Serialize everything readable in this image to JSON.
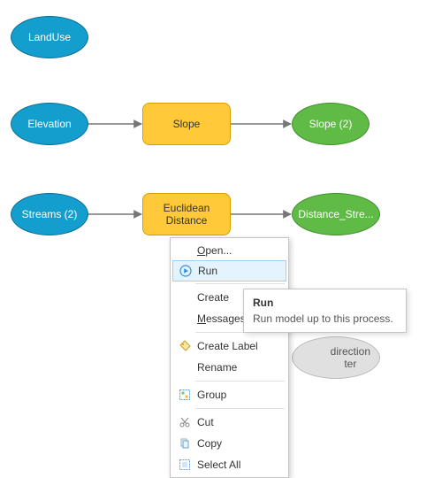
{
  "nodes": {
    "landuse": {
      "label": "LandUse"
    },
    "elevation": {
      "label": "Elevation"
    },
    "slope_tool": {
      "label": "Slope"
    },
    "slope_out": {
      "label": "Slope (2)"
    },
    "streams": {
      "label": "Streams (2)"
    },
    "eucdist": {
      "label": "Euclidean\nDistance"
    },
    "dist_out": {
      "label": "Distance_Stre..."
    },
    "outdir": {
      "label": "direction\nter"
    }
  },
  "menu": {
    "open": "Open...",
    "run": "Run",
    "create": "Create",
    "messages": "Messages",
    "createLabel": "Create Label",
    "rename": "Rename",
    "group": "Group",
    "cut": "Cut",
    "copy": "Copy",
    "selectAll": "Select All"
  },
  "tooltip": {
    "title": "Run",
    "body": "Run model up to this process."
  },
  "colors": {
    "blue": "#149ece",
    "yellow": "#ffc93a",
    "green": "#5fbb46",
    "grey": "#e0e0e0",
    "menuHighlight": "#e5f3ff"
  }
}
